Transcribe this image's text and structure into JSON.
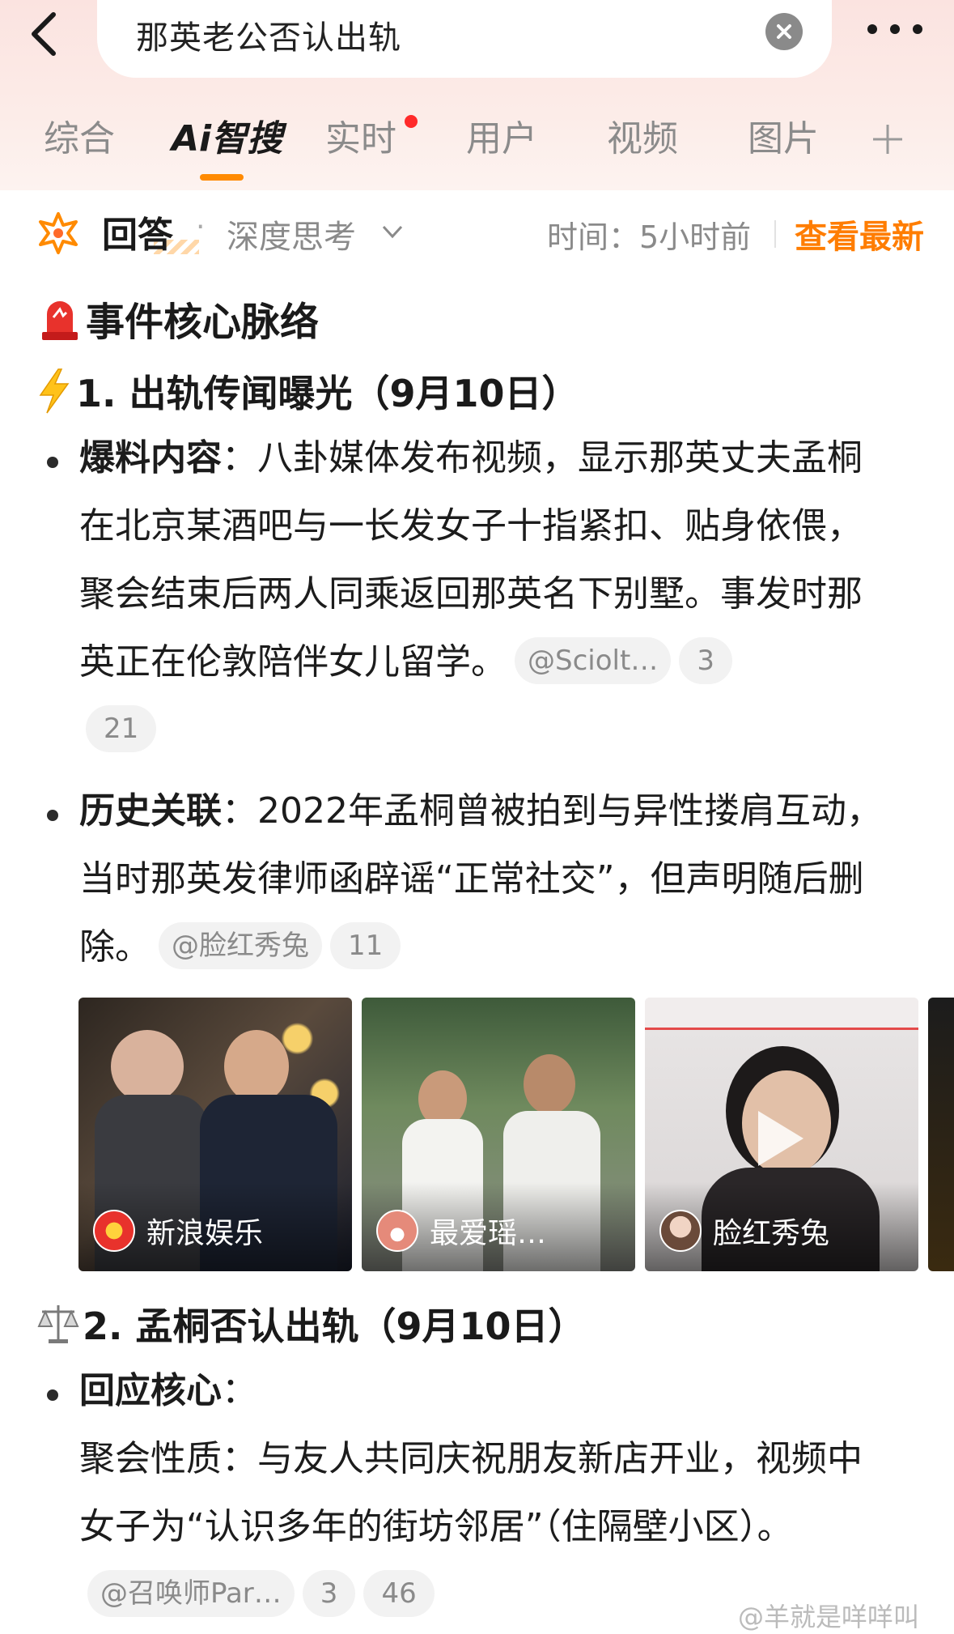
{
  "search": {
    "query": "那英老公否认出轨"
  },
  "tabs": [
    {
      "label": "综合"
    },
    {
      "label": "Ai智搜"
    },
    {
      "label": "实时"
    },
    {
      "label": "用户"
    },
    {
      "label": "视频"
    },
    {
      "label": "图片"
    }
  ],
  "answer_bar": {
    "title": "回答",
    "separator": "·",
    "mode": "深度思考",
    "time": "时间：5小时前",
    "latest_link": "查看最新"
  },
  "content": {
    "section_title": "事件核心脉络",
    "sub1": {
      "title": "1. 出轨传闻曝光（9月10日）",
      "item1": {
        "label": "爆料内容",
        "colon": "：",
        "text": "八卦媒体发布视频，显示那英丈夫孟桐在北京某酒吧与一长发女子十指紧扣、贴身依偎，聚会结束后两人同乘返回那英名下别墅。事发时那英正在伦敦陪伴女儿留学。",
        "chip_source": "@Sciolt…",
        "chip_n1": "3",
        "chip_n2": "21"
      },
      "item2": {
        "label": "历史关联",
        "colon": "：",
        "text": "2022年孟桐曾被拍到与异性搂肩互动，当时那英发律师函辟谣“正常社交”，但声明随后删除。",
        "chip_source": "@脸红秀兔",
        "chip_n1": "11"
      }
    },
    "gallery": [
      {
        "source": "新浪娱乐"
      },
      {
        "source": "最爱瑶…"
      },
      {
        "source": "脸红秀兔"
      }
    ],
    "sub2": {
      "title": "2. 孟桐否认出轨（9月10日）",
      "item1": {
        "label": "回应核心",
        "colon": "：",
        "text": "聚会性质：与友人共同庆祝朋友新店开业，视频中女子为“认识多年的街坊邻居”（住隔壁小区）。",
        "chip_source": "@召唤师Par…",
        "chip_n1": "3",
        "chip_n2": "46"
      }
    }
  },
  "watermark": "@羊就是咩咩叫",
  "colors": {
    "accent": "#ff7d00",
    "header_bg": "#fbe3e0",
    "red_dot": "#ff2a2a"
  }
}
